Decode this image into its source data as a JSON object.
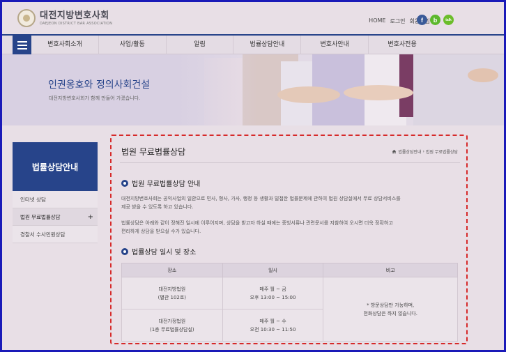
{
  "header": {
    "logo_ko": "대전지방변호사회",
    "logo_en": "DAEJEON DISTRICT BAR ASSOCIATION",
    "util_links": [
      "HOME",
      "로그인",
      "회원가입"
    ],
    "social": [
      "f",
      "b",
      "talk"
    ]
  },
  "nav": {
    "items": [
      "변호사회소개",
      "사업/활동",
      "알림",
      "법률상담안내",
      "변호사안내",
      "변호사전용"
    ]
  },
  "banner": {
    "title": "인권옹호와 정의사회건설",
    "subtitle": "대전지방변호사회가 함께 만들어 가겠습니다."
  },
  "sidebar": {
    "heading": "법률상담안내",
    "items": [
      {
        "label": "인터넷 상담",
        "active": false
      },
      {
        "label": "법원 무료법률상담",
        "active": true,
        "marker": "+"
      },
      {
        "label": "경찰서 수사민원상담",
        "active": false
      }
    ]
  },
  "content": {
    "title": "법원 무료법률상담",
    "breadcrumb": [
      "법률상담안내",
      "›",
      "법원 무료법률상담"
    ],
    "section1": {
      "heading": "법원 무료법률상담 안내",
      "para1_line1": "대전지방변호사회는 공익사업의 일환으로 민사, 형사, 가사, 행정 등 생활과 밀접한 법률문제에 관하여 법원 상담실에서 무료 상담서비스를",
      "para1_line2": "제공 받을 수 있도록 하고 있습니다.",
      "para2_line1": "법률상담은 아래와 같이 정해진 일시에 이루어지며, 상담을 받고자 하실 때에는 증빙서류나 관련문서를 지참하여 오시면 더욱 정확하고",
      "para2_line2": "편리하게 상담을 받으실 수가 있습니다."
    },
    "section2": {
      "heading": "법률상담 일시 및 장소",
      "table": {
        "headers": [
          "장소",
          "일시",
          "비고"
        ],
        "rows": [
          {
            "place_line1": "대전지방법원",
            "place_line2": "(별관 102호)",
            "time_line1": "매주 월 ~ 금",
            "time_line2": "오후 13:00 ~ 15:00"
          },
          {
            "place_line1": "대전가정법원",
            "place_line2": "(1층 무료법률상담실)",
            "time_line1": "매주 월 ~ 수",
            "time_line2": "오전 10:30 ~ 11:50"
          }
        ],
        "note_line1": "* 방문상담만 가능하며,",
        "note_line2": "전화상담은 하지 않습니다."
      }
    }
  },
  "colors": {
    "primary": "#27448a",
    "border_highlight": "#d62a2a",
    "page_bg": "#e8dfe6",
    "outer_frame": "#1a1ab8"
  }
}
